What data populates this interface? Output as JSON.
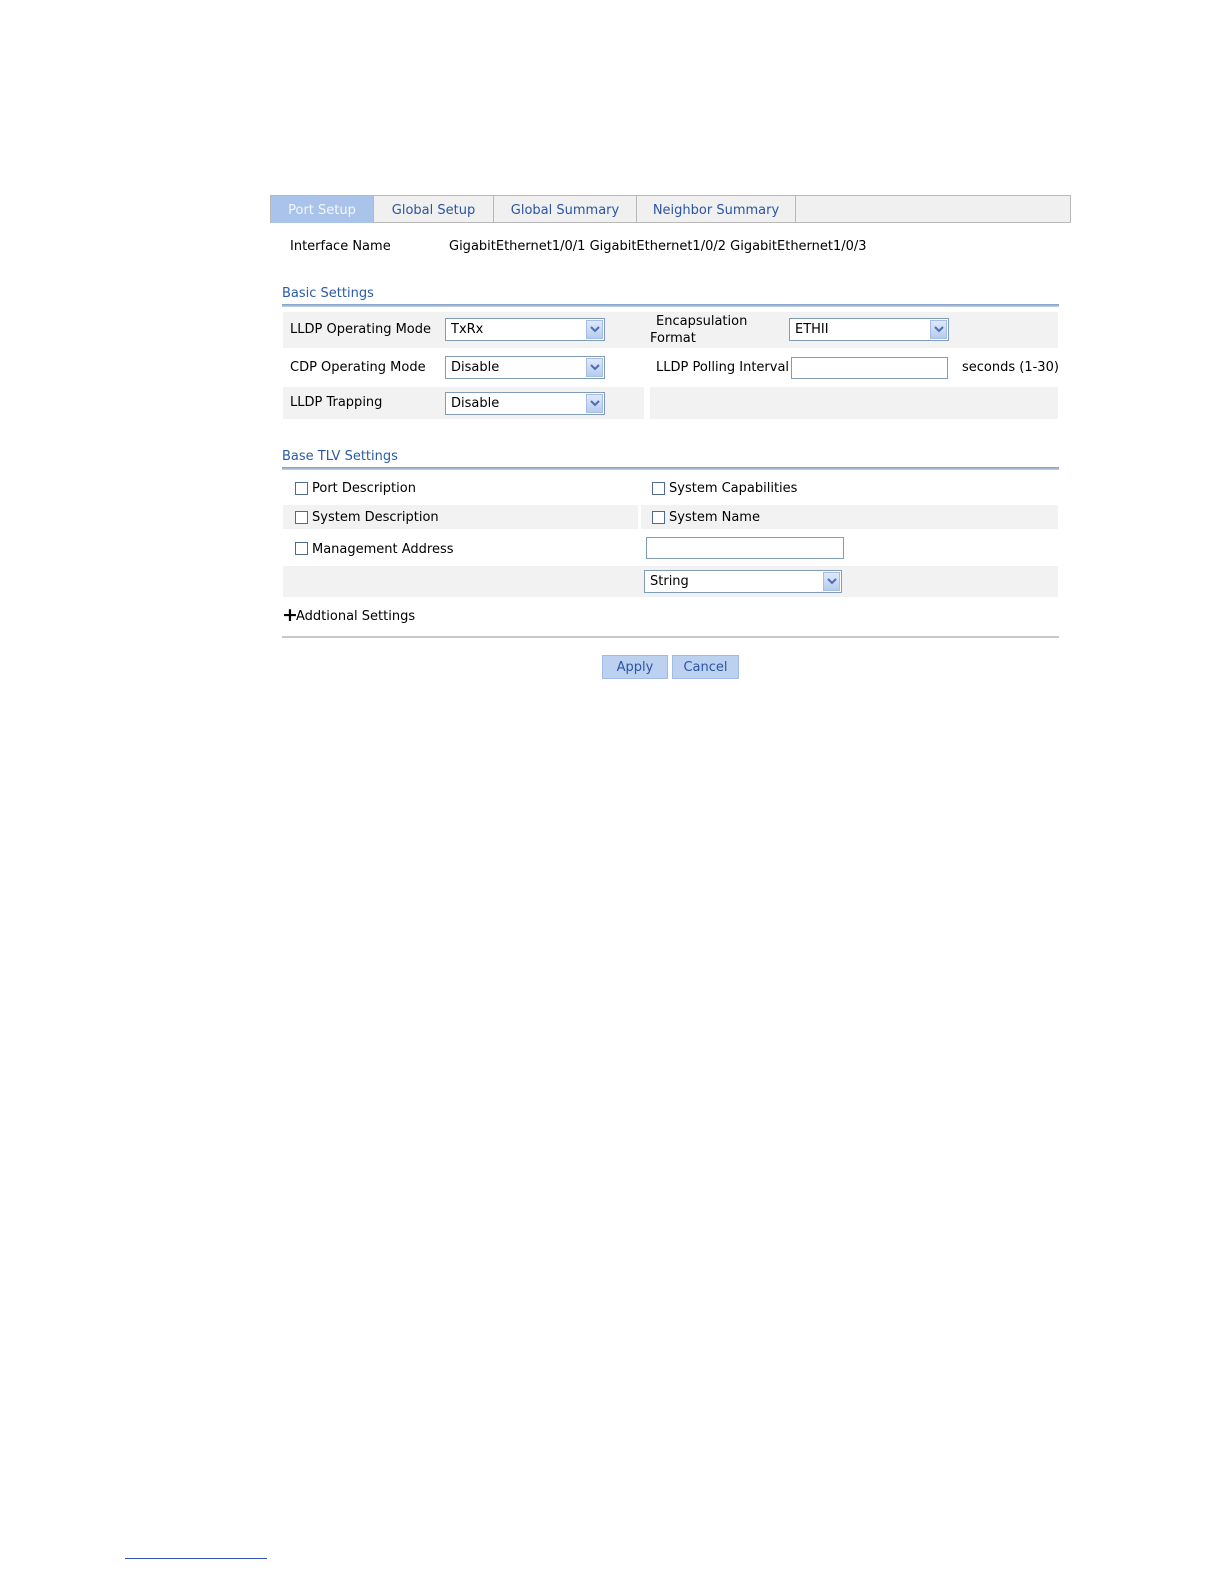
{
  "tabs": [
    {
      "label": "Port Setup",
      "active": true
    },
    {
      "label": "Global Setup",
      "active": false
    },
    {
      "label": "Global Summary",
      "active": false
    },
    {
      "label": "Neighbor Summary",
      "active": false
    }
  ],
  "interface": {
    "label": "Interface Name",
    "value": "GigabitEthernet1/0/1 GigabitEthernet1/0/2 GigabitEthernet1/0/3"
  },
  "basic_settings": {
    "title": "Basic Settings",
    "lldp_operating_mode": {
      "label": "LLDP Operating Mode",
      "value": "TxRx"
    },
    "encapsulation_format": {
      "label_line1": "Encapsulation",
      "label_line2": "Format",
      "value": "ETHII"
    },
    "cdp_operating_mode": {
      "label": "CDP Operating Mode",
      "value": "Disable"
    },
    "lldp_polling_interval": {
      "label": "LLDP Polling Interval",
      "value": "",
      "unit": "seconds (1-30)"
    },
    "lldp_trapping": {
      "label": "LLDP Trapping",
      "value": "Disable"
    }
  },
  "base_tlv_settings": {
    "title": "Base TLV Settings",
    "port_description": {
      "label": "Port Description",
      "checked": false
    },
    "system_capabilities": {
      "label": "System Capabilities",
      "checked": false
    },
    "system_description": {
      "label": "System Description",
      "checked": false
    },
    "system_name": {
      "label": "System Name",
      "checked": false
    },
    "management_address": {
      "label": "Management Address",
      "checked": false,
      "value": "",
      "format": "String"
    }
  },
  "additional_settings": {
    "expand_symbol": "+",
    "label": "Addtional Settings"
  },
  "actions": {
    "apply": "Apply",
    "cancel": "Cancel"
  },
  "colors": {
    "accent": "#2a5ba8",
    "active_tab": "#a9c3ea",
    "button": "#bcd1f0"
  }
}
